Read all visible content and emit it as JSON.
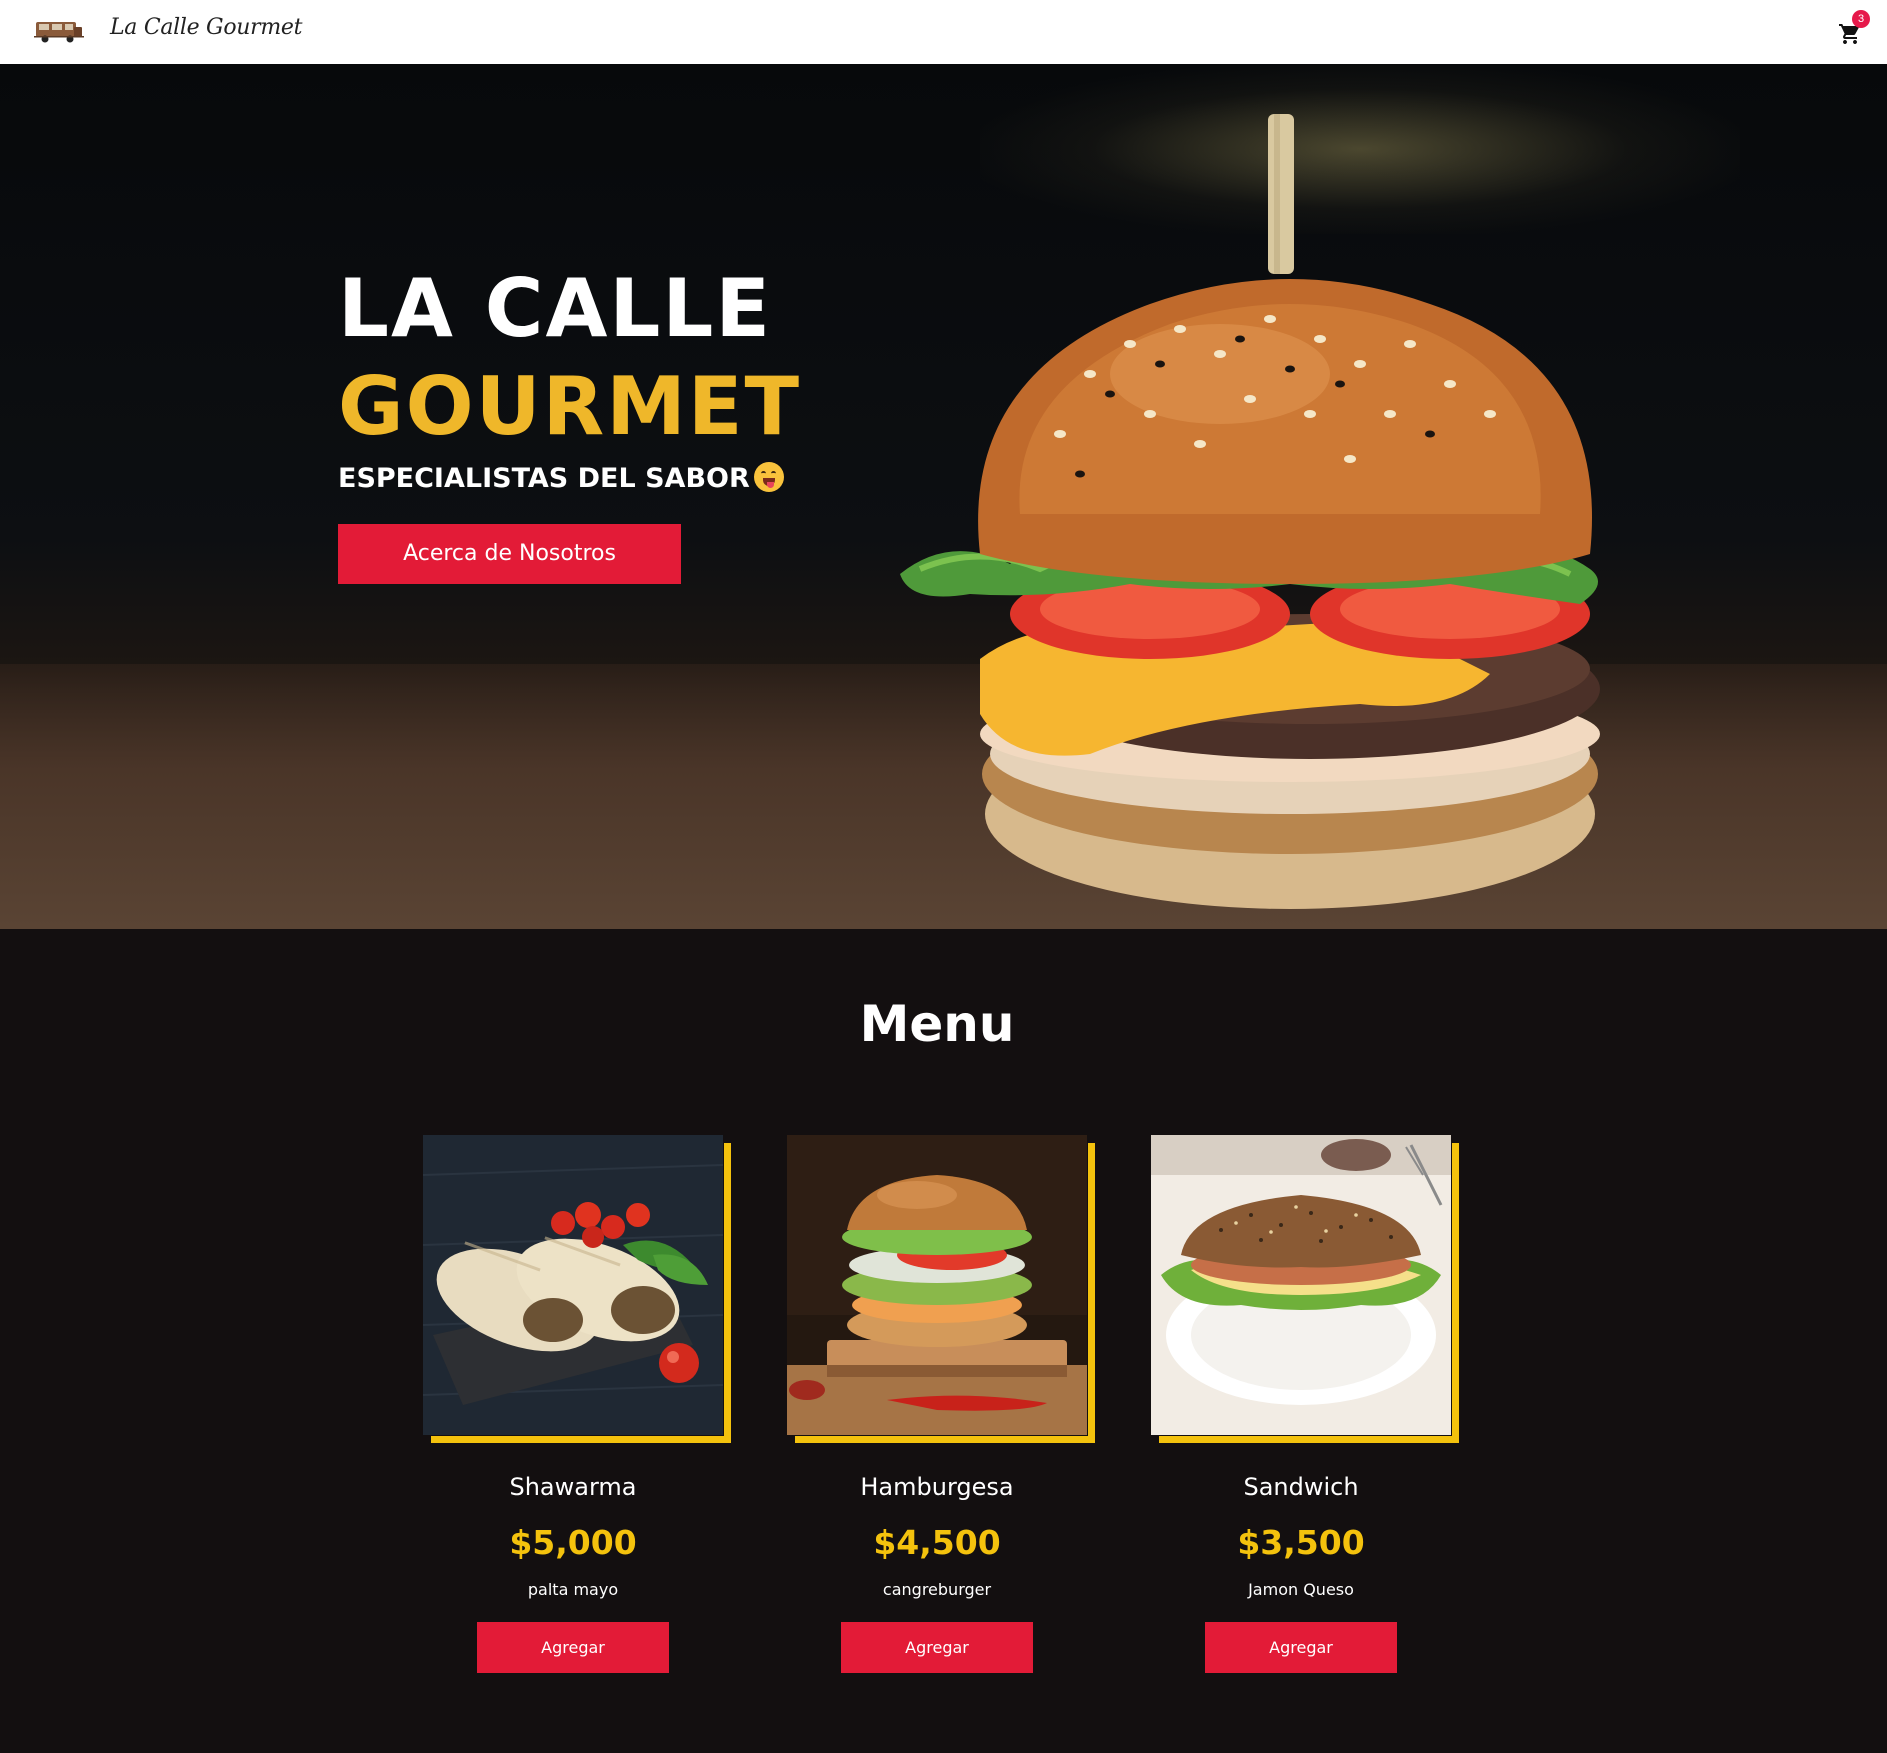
{
  "navbar": {
    "brand": "La Calle Gourmet",
    "cart_count": "3"
  },
  "hero": {
    "title_line1": "LA CALLE",
    "title_line2": "GOURMET",
    "subtitle": "ESPECIALISTAS DEL SABOR",
    "button_label": "Acerca de Nosotros"
  },
  "menu": {
    "title": "Menu",
    "items": [
      {
        "name": "Shawarma",
        "price": "$5,000",
        "description": "palta mayo",
        "button_label": "Agregar"
      },
      {
        "name": "Hamburgesa",
        "price": "$4,500",
        "description": "cangreburger",
        "button_label": "Agregar"
      },
      {
        "name": "Sandwich",
        "price": "$3,500",
        "description": "Jamon Queso",
        "button_label": "Agregar"
      }
    ]
  },
  "colors": {
    "accent_red": "#e31b37",
    "accent_yellow": "#f4c20d",
    "title_gold": "#efb72a",
    "background_dark": "#130f10"
  }
}
